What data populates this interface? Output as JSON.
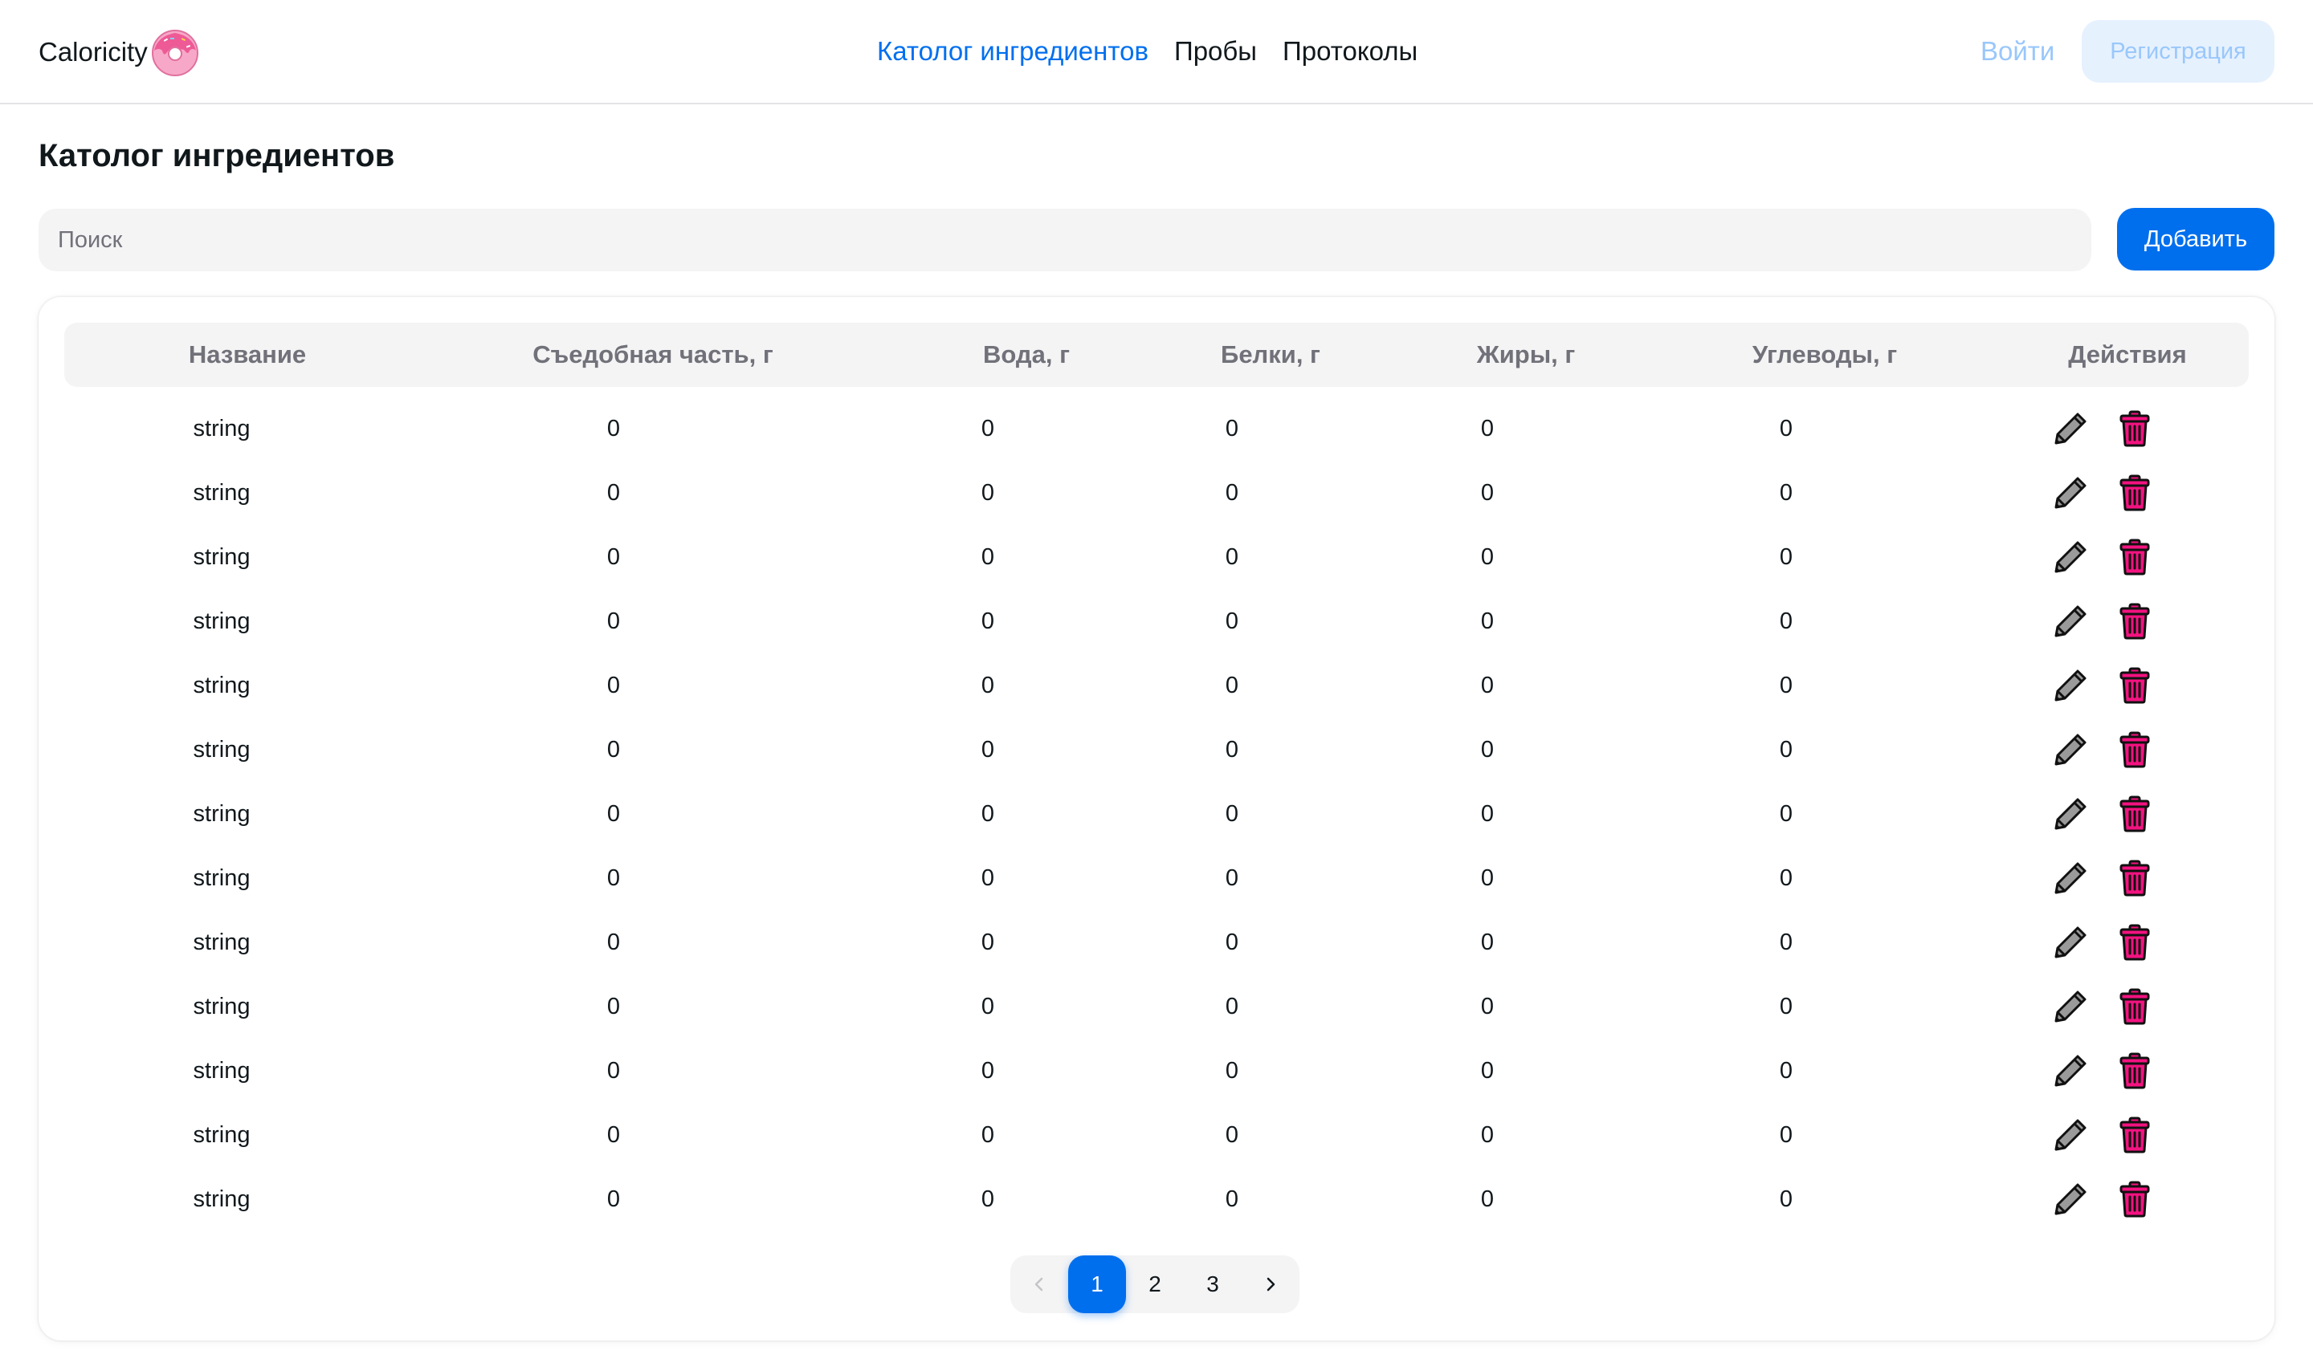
{
  "header": {
    "brand": "Caloricity",
    "nav": [
      "Католог ингредиентов",
      "Пробы",
      "Протоколы"
    ],
    "active_nav": 0,
    "login": "Войти",
    "register": "Регистрация"
  },
  "page": {
    "title": "Католог ингредиентов",
    "search_placeholder": "Поиск",
    "add_button": "Добавить"
  },
  "table": {
    "columns": [
      "Название",
      "Съедобная часть, г",
      "Вода, г",
      "Белки, г",
      "Жиры, г",
      "Углеводы, г",
      "Действия"
    ],
    "rows": [
      [
        "string",
        "0",
        "0",
        "0",
        "0",
        "0"
      ],
      [
        "string",
        "0",
        "0",
        "0",
        "0",
        "0"
      ],
      [
        "string",
        "0",
        "0",
        "0",
        "0",
        "0"
      ],
      [
        "string",
        "0",
        "0",
        "0",
        "0",
        "0"
      ],
      [
        "string",
        "0",
        "0",
        "0",
        "0",
        "0"
      ],
      [
        "string",
        "0",
        "0",
        "0",
        "0",
        "0"
      ],
      [
        "string",
        "0",
        "0",
        "0",
        "0",
        "0"
      ],
      [
        "string",
        "0",
        "0",
        "0",
        "0",
        "0"
      ],
      [
        "string",
        "0",
        "0",
        "0",
        "0",
        "0"
      ],
      [
        "string",
        "0",
        "0",
        "0",
        "0",
        "0"
      ],
      [
        "string",
        "0",
        "0",
        "0",
        "0",
        "0"
      ],
      [
        "string",
        "0",
        "0",
        "0",
        "0",
        "0"
      ],
      [
        "string",
        "0",
        "0",
        "0",
        "0",
        "0"
      ]
    ],
    "row_actions": [
      "pencil-icon",
      "trash-icon"
    ]
  },
  "pagination": {
    "pages": [
      "1",
      "2",
      "3"
    ],
    "current": "1",
    "prev_icon": "chevron-left-icon",
    "next_icon": "chevron-right-icon"
  },
  "colors": {
    "accent": "#006fee",
    "accent_soft": "#e6f1fe",
    "delete": "#f31280",
    "logo": "#f17aa8"
  }
}
